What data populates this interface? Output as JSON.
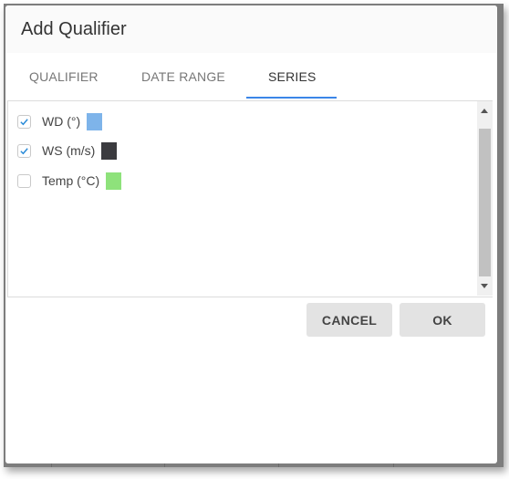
{
  "dialog": {
    "title": "Add Qualifier",
    "tabs": [
      {
        "label": "QUALIFIER",
        "active": false
      },
      {
        "label": "DATE RANGE",
        "active": false
      },
      {
        "label": "SERIES",
        "active": true
      }
    ],
    "accent_color": "#3b86e8",
    "series": [
      {
        "label": "WD (°)",
        "checked": true,
        "color": "#7eb4ea"
      },
      {
        "label": "WS (m/s)",
        "checked": true,
        "color": "#3b3b3f"
      },
      {
        "label": "Temp (°C)",
        "checked": false,
        "color": "#8ee27b"
      }
    ],
    "buttons": {
      "cancel": "CANCEL",
      "ok": "OK"
    }
  }
}
